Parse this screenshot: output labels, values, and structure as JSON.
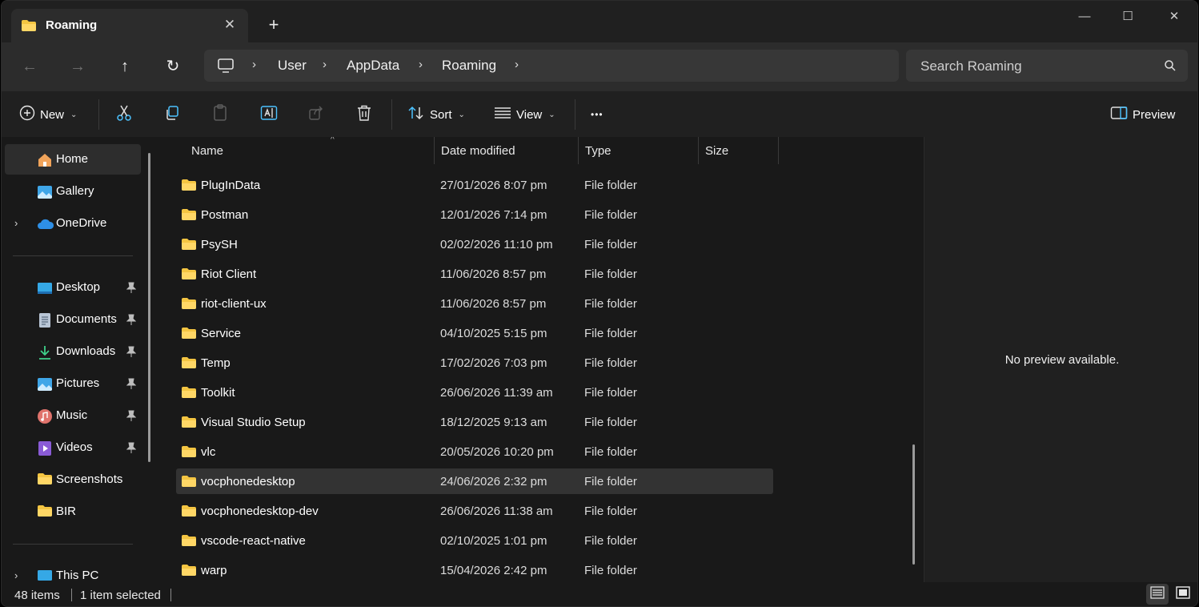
{
  "tab": {
    "title": "Roaming",
    "close_glyph": "✕",
    "new_tab_glyph": "+"
  },
  "window_controls": {
    "minimize": "—",
    "maximize": "☐",
    "close": "✕"
  },
  "nav": {
    "back": "←",
    "forward": "→",
    "up": "↑",
    "refresh": "↻"
  },
  "breadcrumb": {
    "sep": "›",
    "items": [
      "User",
      "AppData",
      "Roaming"
    ]
  },
  "search": {
    "placeholder": "Search Roaming"
  },
  "toolbar": {
    "new_label": "New",
    "sort_label": "Sort",
    "view_label": "View",
    "more_glyph": "•••",
    "preview_label": "Preview",
    "caret": "⌄"
  },
  "sidebar": {
    "expander": "›",
    "items": [
      {
        "label": "Home",
        "icon": "home-icon"
      },
      {
        "label": "Gallery",
        "icon": "gallery-icon"
      },
      {
        "label": "OneDrive",
        "icon": "cloud-icon"
      },
      {
        "label": "Desktop",
        "icon": "desktop-icon"
      },
      {
        "label": "Documents",
        "icon": "documents-icon"
      },
      {
        "label": "Downloads",
        "icon": "download-icon"
      },
      {
        "label": "Pictures",
        "icon": "pictures-icon"
      },
      {
        "label": "Music",
        "icon": "music-icon"
      },
      {
        "label": "Videos",
        "icon": "videos-icon"
      },
      {
        "label": "Screenshots",
        "icon": "folder-icon"
      },
      {
        "label": "BIR",
        "icon": "folder-icon"
      },
      {
        "label": "This PC",
        "icon": "pc-icon"
      }
    ]
  },
  "columns": {
    "name": "Name",
    "date": "Date modified",
    "type": "Type",
    "size": "Size",
    "sort_glyph": "^"
  },
  "files": [
    {
      "name": "PlugInData",
      "date": "27/01/2026 8:07 pm",
      "type": "File folder"
    },
    {
      "name": "Postman",
      "date": "12/01/2026 7:14 pm",
      "type": "File folder"
    },
    {
      "name": "PsySH",
      "date": "02/02/2026 11:10 pm",
      "type": "File folder"
    },
    {
      "name": "Riot Client",
      "date": "11/06/2026 8:57 pm",
      "type": "File folder"
    },
    {
      "name": "riot-client-ux",
      "date": "11/06/2026 8:57 pm",
      "type": "File folder"
    },
    {
      "name": "Service",
      "date": "04/10/2025 5:15 pm",
      "type": "File folder"
    },
    {
      "name": "Temp",
      "date": "17/02/2026 7:03 pm",
      "type": "File folder"
    },
    {
      "name": "Toolkit",
      "date": "26/06/2026 11:39 am",
      "type": "File folder"
    },
    {
      "name": "Visual Studio Setup",
      "date": "18/12/2025 9:13 am",
      "type": "File folder"
    },
    {
      "name": "vlc",
      "date": "20/05/2026 10:20 pm",
      "type": "File folder"
    },
    {
      "name": "vocphonedesktop",
      "date": "24/06/2026 2:32 pm",
      "type": "File folder"
    },
    {
      "name": "vocphonedesktop-dev",
      "date": "26/06/2026 11:38 am",
      "type": "File folder"
    },
    {
      "name": "vscode-react-native",
      "date": "02/10/2025 1:01 pm",
      "type": "File folder"
    },
    {
      "name": "warp",
      "date": "15/04/2026 2:42 pm",
      "type": "File folder"
    }
  ],
  "preview": {
    "message": "No preview available."
  },
  "status": {
    "count": "48 items",
    "selection": "1 item selected"
  },
  "colors": {
    "folder": "#F4C542",
    "accent": "#4CC2FF"
  }
}
